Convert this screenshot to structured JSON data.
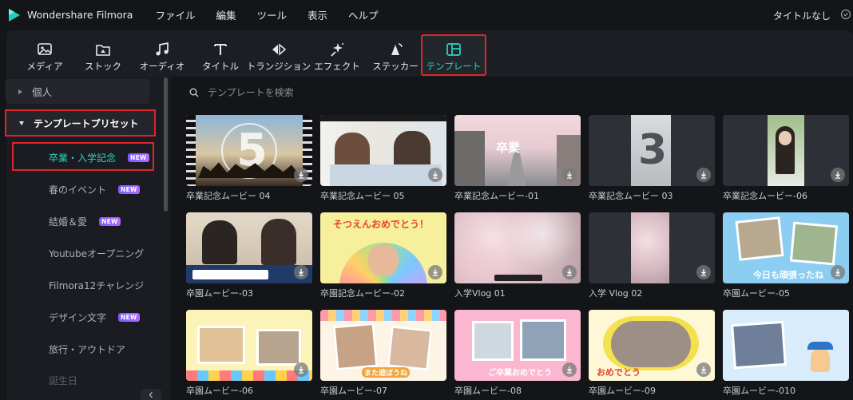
{
  "app": {
    "name": "Wondershare Filmora",
    "project_title": "タイトルなし"
  },
  "menu": [
    "ファイル",
    "編集",
    "ツール",
    "表示",
    "ヘルプ"
  ],
  "toolbar": [
    {
      "label": "メディア",
      "icon": "media-icon"
    },
    {
      "label": "ストック",
      "icon": "stock-icon"
    },
    {
      "label": "オーディオ",
      "icon": "audio-icon"
    },
    {
      "label": "タイトル",
      "icon": "title-icon"
    },
    {
      "label": "トランジション",
      "icon": "transition-icon"
    },
    {
      "label": "エフェクト",
      "icon": "effect-icon"
    },
    {
      "label": "ステッカー",
      "icon": "sticker-icon"
    },
    {
      "label": "テンプレート",
      "icon": "template-icon",
      "active": true
    }
  ],
  "sidebar": {
    "personal": "個人",
    "preset": "テンプレートプリセット",
    "items": [
      {
        "label": "卒業・入学記念",
        "badge": "NEW",
        "active": true
      },
      {
        "label": "春のイベント",
        "badge": "NEW"
      },
      {
        "label": "結婚＆愛",
        "badge": "NEW"
      },
      {
        "label": "Youtubeオープニング"
      },
      {
        "label": "Filmora12チャレンジ"
      },
      {
        "label": "デザイン文字",
        "badge": "NEW"
      },
      {
        "label": "旅行・アウトドア"
      },
      {
        "label": "誕生日"
      }
    ]
  },
  "search": {
    "placeholder": "テンプレートを検索"
  },
  "templates": [
    {
      "caption": "卒業記念ムービー 04",
      "overlay": "5"
    },
    {
      "caption": "卒業記念ムービー 05",
      "overlay": ""
    },
    {
      "caption": "卒業記念ムービー-01",
      "overlay": "卒業"
    },
    {
      "caption": "卒業記念ムービー 03",
      "overlay": "3"
    },
    {
      "caption": "卒業記念ムービー-06",
      "overlay": ""
    },
    {
      "caption": "卒園ムービー-03",
      "overlay": ""
    },
    {
      "caption": "卒園記念ムービー-02",
      "overlay": "そつえんおめでとう！"
    },
    {
      "caption": "入学Vlog 01",
      "overlay": ""
    },
    {
      "caption": "入学 Vlog 02",
      "overlay": ""
    },
    {
      "caption": "卒園ムービー-05",
      "overlay": "今日も頑張ったね"
    },
    {
      "caption": "卒園ムービー-06",
      "overlay": ""
    },
    {
      "caption": "卒園ムービー-07",
      "overlay": "また遊ぼうね"
    },
    {
      "caption": "卒園ムービー-08",
      "overlay": "ご卒業おめでとう"
    },
    {
      "caption": "卒園ムービー-09",
      "overlay": "おめでとう"
    },
    {
      "caption": "卒園ムービー-010",
      "overlay": ""
    }
  ],
  "colors": {
    "accent": "#27d6c5",
    "highlight": "#e0242c",
    "badge": "#8a5cff"
  }
}
